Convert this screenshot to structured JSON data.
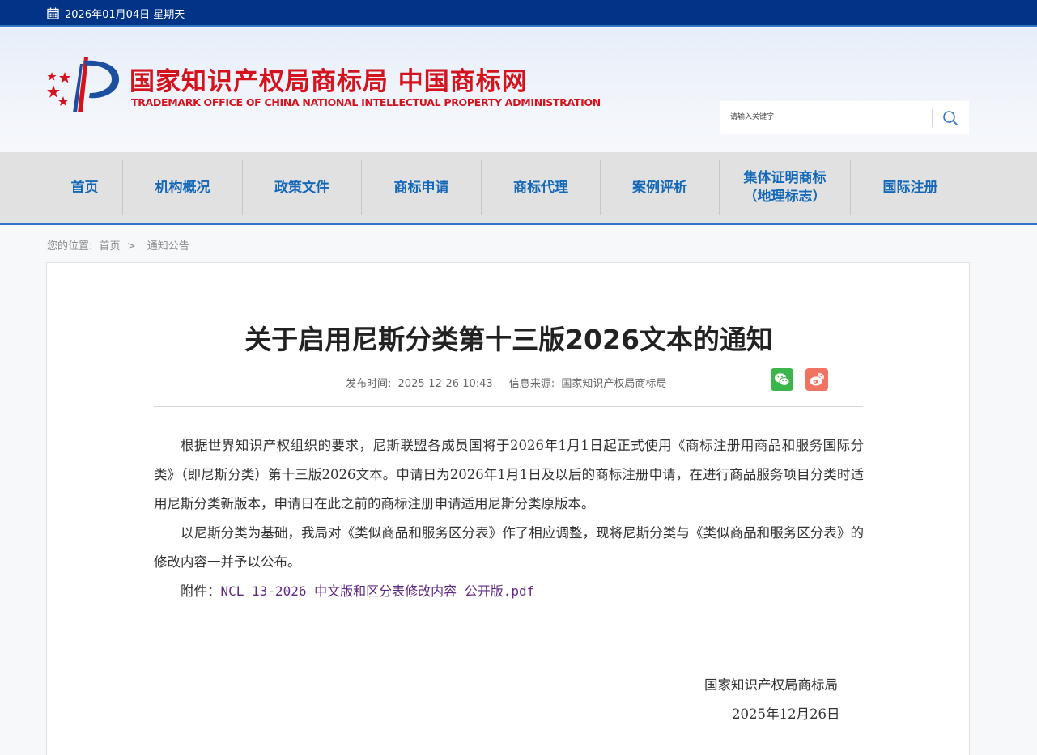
{
  "topbar": {
    "date": "2026年01月04日 星期天"
  },
  "header": {
    "site_name_cn": "国家知识产权局商标局 中国商标网",
    "site_name_en": "TRADEMARK OFFICE OF CHINA NATIONAL INTELLECTUAL PROPERTY ADMINISTRATION",
    "search_placeholder": "请输入关键字"
  },
  "nav": {
    "items": [
      {
        "label": "首页"
      },
      {
        "label": "机构概况"
      },
      {
        "label": "政策文件"
      },
      {
        "label": "商标申请"
      },
      {
        "label": "商标代理"
      },
      {
        "label": "案例评析"
      },
      {
        "label": "集体证明商标\n（地理标志）"
      },
      {
        "label": "国际注册"
      }
    ]
  },
  "breadcrumb": {
    "prefix": "您的位置:",
    "home": "首页",
    "separator": ">",
    "current": "通知公告"
  },
  "article": {
    "title": "关于启用尼斯分类第十三版2026文本的通知",
    "publish_label": "发布时间:",
    "publish_time": "2025-12-26 10:43",
    "source_label": "信息来源:",
    "source": "国家知识产权局商标局",
    "paragraphs": [
      "根据世界知识产权组织的要求，尼斯联盟各成员国将于2026年1月1日起正式使用《商标注册用商品和服务国际分类》（即尼斯分类）第十三版2026文本。申请日为2026年1月1日及以后的商标注册申请，在进行商品服务项目分类时适用尼斯分类新版本，申请日在此之前的商标注册申请适用尼斯分类原版本。",
      "以尼斯分类为基础，我局对《类似商品和服务区分表》作了相应调整，现将尼斯分类与《类似商品和服务区分表》的修改内容一并予以公布。"
    ],
    "attachment_label": "附件：",
    "attachment_name": "NCL 13-2026 中文版和区分表修改内容 公开版.pdf",
    "signature_org": "国家知识产权局商标局",
    "signature_date": "2025年12月26日"
  },
  "colors": {
    "topbar": "#013386",
    "nav_text": "#1468b8",
    "logo_red": "#d3141e",
    "wechat": "#3bb64a",
    "weibo": "#ef7562",
    "link": "#5f2a86"
  },
  "icons": [
    "calendar-icon",
    "search-icon",
    "wechat-icon",
    "weibo-icon"
  ]
}
